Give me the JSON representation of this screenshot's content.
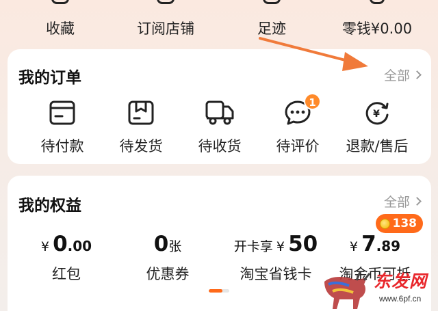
{
  "top_row": {
    "items": [
      {
        "label": "收藏"
      },
      {
        "label": "订阅店铺"
      },
      {
        "label": "足迹"
      },
      {
        "label": "零钱¥0.00"
      }
    ]
  },
  "orders": {
    "title": "我的订单",
    "view_all": "全部",
    "items": [
      {
        "label": "待付款",
        "icon": "card-icon"
      },
      {
        "label": "待发货",
        "icon": "package-icon"
      },
      {
        "label": "待收货",
        "icon": "truck-icon"
      },
      {
        "label": "待评价",
        "icon": "chat-icon",
        "badge": "1"
      },
      {
        "label": "退款/售后",
        "icon": "refund-icon"
      }
    ]
  },
  "benefits": {
    "title": "我的权益",
    "view_all": "全部",
    "items": [
      {
        "currency": "¥",
        "value_int": "0",
        "value_dec": ".00",
        "label": "红包"
      },
      {
        "value_int": "0",
        "unit": "张",
        "label": "优惠券"
      },
      {
        "prefix": "开卡享",
        "currency": "¥",
        "value_int": "50",
        "label": "淘宝省钱卡"
      },
      {
        "currency": "¥",
        "value_int": "7",
        "value_dec": ".89",
        "label": "淘金币可抵",
        "coin_badge": "138"
      }
    ],
    "pager": {
      "active_index": 0,
      "count": 2
    }
  },
  "watermark": {
    "brand": "东发网",
    "url": "www.6pf.cn"
  },
  "colors": {
    "accent": "#ff6a1a",
    "arrow": "#f07a3a",
    "badge": "#ff8a2a",
    "card": "#ffffff"
  }
}
